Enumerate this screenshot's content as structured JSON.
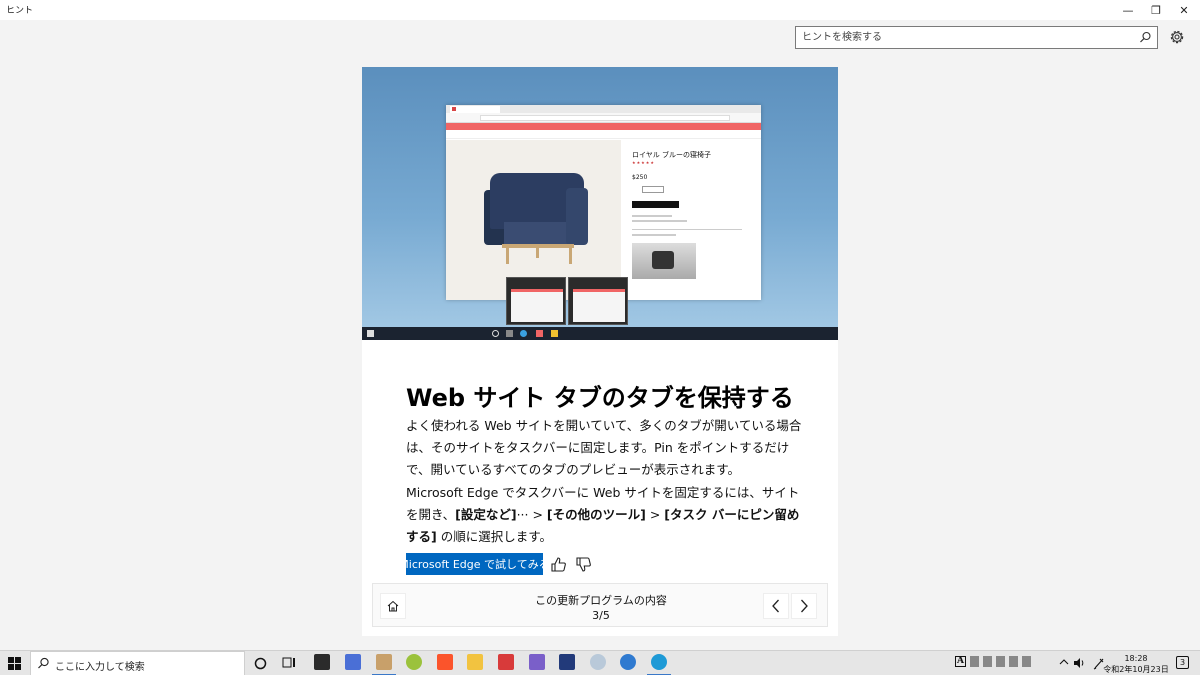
{
  "window": {
    "title": "ヒント",
    "min_glyph": "—",
    "restore_glyph": "❐",
    "close_glyph": "✕"
  },
  "search": {
    "placeholder": "ヒントを検索する"
  },
  "hero": {
    "product_title": "ロイヤル ブルーの寝椅子",
    "price": "$250",
    "stars": "★★★★★"
  },
  "tip": {
    "headline": "Web サイト タブのタブを保持する",
    "paragraph1": "よく使われる Web サイトを開いていて、多くのタブが開いている場合は、そのサイトをタスクバーに固定します。Pin をポイントするだけで、開いているすべてのタブのプレビューが表示されます。",
    "paragraph2_pre": "Microsoft Edge でタスクバーに Web サイトを固定するには、サイトを開き、",
    "paragraph2_b1": "[設定など]",
    "paragraph2_mid1": "··· > ",
    "paragraph2_b2": "[その他のツール]",
    "paragraph2_mid2": " > ",
    "paragraph2_b3": "[タスク バーにピン留めする]",
    "paragraph2_post": " の順に選択します。",
    "try_button": "Microsoft Edge で試してみる"
  },
  "footer": {
    "title": "この更新プログラムの内容",
    "page": "3/5"
  },
  "taskbar": {
    "search_placeholder": "ここに入力して検索",
    "time": "18:28",
    "date": "令和2年10月23日",
    "notification_count": "3"
  },
  "colors": {
    "accent": "#0067c0",
    "background": "#f3f3f3",
    "card": "#ffffff"
  }
}
